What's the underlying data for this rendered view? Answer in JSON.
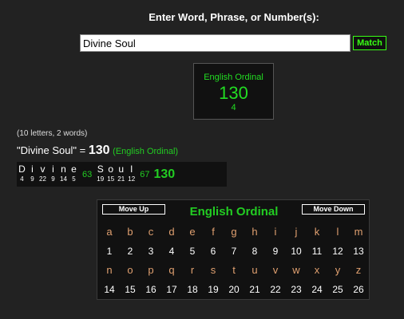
{
  "header": {
    "prompt": "Enter Word, Phrase, or Number(s):"
  },
  "search": {
    "value": "Divine Soul",
    "button_label": "Match"
  },
  "cipher_box": {
    "name": "English Ordinal",
    "value": "130",
    "reduced": "4"
  },
  "stats": "(10 letters, 2 words)",
  "result": {
    "phrase": "\"Divine Soul\"",
    "equals": " = ",
    "value": "130",
    "cipher": "(English Ordinal)"
  },
  "breakdown": {
    "words": [
      {
        "letters": [
          {
            "l": "D",
            "v": "4"
          },
          {
            "l": "i",
            "v": "9"
          },
          {
            "l": "v",
            "v": "22"
          },
          {
            "l": "i",
            "v": "9"
          },
          {
            "l": "n",
            "v": "14"
          },
          {
            "l": "e",
            "v": "5"
          }
        ],
        "sum": "63"
      },
      {
        "letters": [
          {
            "l": "S",
            "v": "19"
          },
          {
            "l": "o",
            "v": "15"
          },
          {
            "l": "u",
            "v": "21"
          },
          {
            "l": "l",
            "v": "12"
          }
        ],
        "sum": "67"
      }
    ],
    "total": "130"
  },
  "table": {
    "title": "English Ordinal",
    "move_up": "Move Up",
    "move_down": "Move Down",
    "rows": [
      {
        "type": "l",
        "cells": [
          "a",
          "b",
          "c",
          "d",
          "e",
          "f",
          "g",
          "h",
          "i",
          "j",
          "k",
          "l",
          "m"
        ]
      },
      {
        "type": "n",
        "cells": [
          "1",
          "2",
          "3",
          "4",
          "5",
          "6",
          "7",
          "8",
          "9",
          "10",
          "11",
          "12",
          "13"
        ]
      },
      {
        "type": "l",
        "cells": [
          "n",
          "o",
          "p",
          "q",
          "r",
          "s",
          "t",
          "u",
          "v",
          "w",
          "x",
          "y",
          "z"
        ]
      },
      {
        "type": "n",
        "cells": [
          "14",
          "15",
          "16",
          "17",
          "18",
          "19",
          "20",
          "21",
          "22",
          "23",
          "24",
          "25",
          "26"
        ]
      }
    ]
  },
  "colors": {
    "accent": "#22cc22",
    "letter": "#e0a070",
    "background": "#222222"
  }
}
